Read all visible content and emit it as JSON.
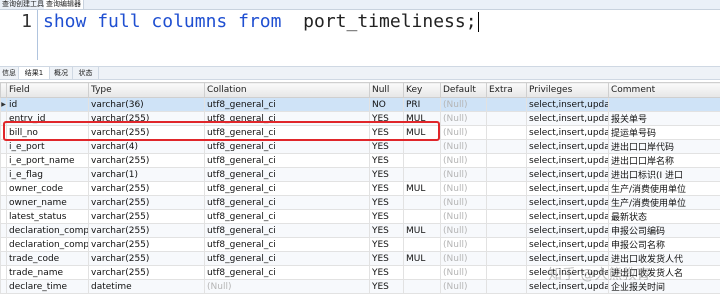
{
  "toolbar": {
    "tab1": "查询创建工具",
    "tab2": "查询编辑器"
  },
  "editor": {
    "line_number": "1",
    "sql_keywords": [
      "show",
      "full",
      "columns",
      "from"
    ],
    "sql_table": "port_timeliness;"
  },
  "result_tabs": [
    "信息",
    "结果1",
    "概况",
    "状态"
  ],
  "grid": {
    "columns": [
      "Field",
      "Type",
      "Collation",
      "Null",
      "Key",
      "Default",
      "Extra",
      "Privileges",
      "Comment"
    ],
    "rows": [
      [
        "id",
        "varchar(36)",
        "utf8_general_ci",
        "NO",
        "PRI",
        "(Null)",
        "",
        "select,insert,update",
        ""
      ],
      [
        "entry_id",
        "varchar(255)",
        "utf8_general_ci",
        "YES",
        "MUL",
        "(Null)",
        "",
        "select,insert,update",
        "报关单号"
      ],
      [
        "bill_no",
        "varchar(255)",
        "utf8_general_ci",
        "YES",
        "MUL",
        "(Null)",
        "",
        "select,insert,update",
        "提运单号码"
      ],
      [
        "i_e_port",
        "varchar(4)",
        "utf8_general_ci",
        "YES",
        "",
        "(Null)",
        "",
        "select,insert,update",
        "进出口口岸代码"
      ],
      [
        "i_e_port_name",
        "varchar(255)",
        "utf8_general_ci",
        "YES",
        "",
        "(Null)",
        "",
        "select,insert,update",
        "进出口口岸名称"
      ],
      [
        "i_e_flag",
        "varchar(1)",
        "utf8_general_ci",
        "YES",
        "",
        "(Null)",
        "",
        "select,insert,update",
        "进出口标识(I 进口"
      ],
      [
        "owner_code",
        "varchar(255)",
        "utf8_general_ci",
        "YES",
        "MUL",
        "(Null)",
        "",
        "select,insert,update",
        "生产/消费使用单位"
      ],
      [
        "owner_name",
        "varchar(255)",
        "utf8_general_ci",
        "YES",
        "",
        "(Null)",
        "",
        "select,insert,update",
        "生产/消费使用单位"
      ],
      [
        "latest_status",
        "varchar(255)",
        "utf8_general_ci",
        "YES",
        "",
        "(Null)",
        "",
        "select,insert,update",
        "最新状态"
      ],
      [
        "declaration_compa",
        "varchar(255)",
        "utf8_general_ci",
        "YES",
        "MUL",
        "(Null)",
        "",
        "select,insert,update",
        "申报公司编码"
      ],
      [
        "declaration_compa",
        "varchar(255)",
        "utf8_general_ci",
        "YES",
        "",
        "(Null)",
        "",
        "select,insert,update",
        "申报公司名称"
      ],
      [
        "trade_code",
        "varchar(255)",
        "utf8_general_ci",
        "YES",
        "MUL",
        "(Null)",
        "",
        "select,insert,update",
        "进出口收发货人代"
      ],
      [
        "trade_name",
        "varchar(255)",
        "utf8_general_ci",
        "YES",
        "",
        "(Null)",
        "",
        "select,insert,update",
        "进出口收发货人名"
      ],
      [
        "declare_time",
        "datetime",
        "(Null)",
        "YES",
        "",
        "(Null)",
        "",
        "select,insert,update",
        "企业报关时间"
      ]
    ]
  },
  "watermark": "知乎 @大熊教育",
  "colors": {
    "keyword": "#1f4fd1",
    "highlight": "#e0262a",
    "null_text": "#b5b5b5",
    "selected_row": "#cfe3f7"
  }
}
